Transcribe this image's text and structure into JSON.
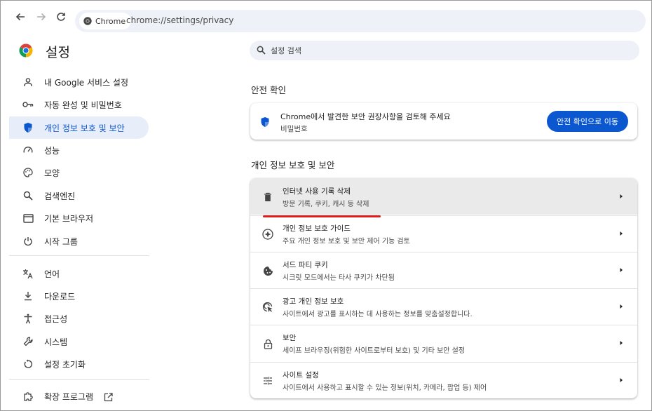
{
  "toolbar": {
    "chip_label": "Chrome",
    "url": "chrome://settings/privacy"
  },
  "header": {
    "title": "설정",
    "search_placeholder": "설정 검색"
  },
  "sidebar": {
    "items": [
      {
        "label": "내 Google 서비스 설정",
        "icon": "person-icon"
      },
      {
        "label": "자동 완성 및 비밀번호",
        "icon": "key-icon"
      },
      {
        "label": "개인 정보 보호 및 보안",
        "icon": "shield-icon",
        "active": true
      },
      {
        "label": "성능",
        "icon": "speedometer-icon"
      },
      {
        "label": "모양",
        "icon": "palette-icon"
      },
      {
        "label": "검색엔진",
        "icon": "search-icon"
      },
      {
        "label": "기본 브라우저",
        "icon": "browser-window-icon"
      },
      {
        "label": "시작 그룹",
        "icon": "power-icon"
      },
      {
        "label": "언어",
        "icon": "translate-icon"
      },
      {
        "label": "다운로드",
        "icon": "download-icon"
      },
      {
        "label": "접근성",
        "icon": "accessibility-icon"
      },
      {
        "label": "시스템",
        "icon": "wrench-icon"
      },
      {
        "label": "설정 초기화",
        "icon": "reset-icon"
      },
      {
        "label": "확장 프로그램",
        "icon": "puzzle-icon"
      }
    ]
  },
  "safety_check": {
    "section_title": "안전 확인",
    "title": "Chrome에서 발견한 보안 권장사항을 검토해 주세요",
    "subtitle": "비밀번호",
    "button_label": "안전 확인으로 이동"
  },
  "privacy": {
    "section_title": "개인 정보 보호 및 보안",
    "rows": [
      {
        "title": "인터넷 사용 기록 삭제",
        "subtitle": "방문 기록, 쿠키, 캐시 등 삭제",
        "icon": "trash-icon"
      },
      {
        "title": "개인 정보 보호 가이드",
        "subtitle": "주요 개인 정보 보호 및 보안 제어 기능 검토",
        "icon": "compass-icon"
      },
      {
        "title": "서드 파티 쿠키",
        "subtitle": "시크릿 모드에서는 타사 쿠키가 차단됨",
        "icon": "cookie-icon"
      },
      {
        "title": "광고 개인 정보 보호",
        "subtitle": "사이트에서 광고를 표시하는 데 사용하는 정보를 맞춤설정합니다.",
        "icon": "ads-click-icon"
      },
      {
        "title": "보안",
        "subtitle": "세이프 브라우징(위험한 사이트로부터 보호) 및 기타 보안 설정",
        "icon": "lock-icon"
      },
      {
        "title": "사이트 설정",
        "subtitle": "사이트에서 사용하고 표시할 수 있는 정보(위치, 카메라, 팝업 등) 제어",
        "icon": "tune-icon"
      }
    ]
  },
  "colors": {
    "accent": "#0b57d0",
    "active_bg": "#e8eef9",
    "annotation": "#e21b1b"
  }
}
